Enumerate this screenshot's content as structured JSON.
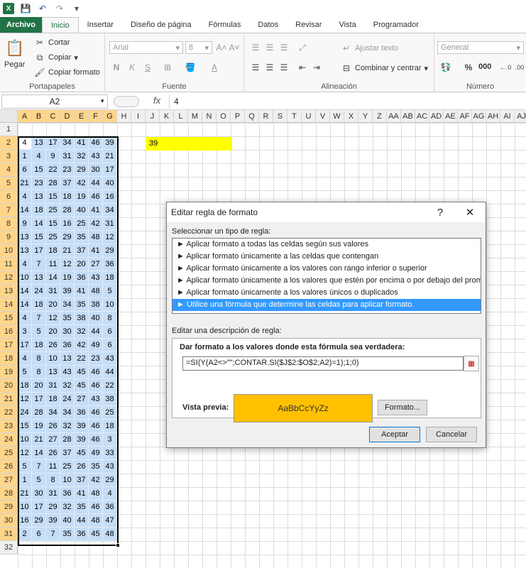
{
  "quick_access": {
    "save_icon": "save-icon",
    "undo_icon": "undo-icon",
    "redo_icon": "redo-icon"
  },
  "tabs": [
    "Archivo",
    "Inicio",
    "Insertar",
    "Diseño de página",
    "Fórmulas",
    "Datos",
    "Revisar",
    "Vista",
    "Programador"
  ],
  "active_tab": "Inicio",
  "ribbon": {
    "clipboard": {
      "paste": "Pegar",
      "cut": "Cortar",
      "copy": "Copiar",
      "format_painter": "Copiar formato",
      "label": "Portapapeles"
    },
    "font": {
      "name": "Arial",
      "size": "8",
      "bold": "N",
      "italic": "K",
      "underline": "S",
      "label": "Fuente"
    },
    "alignment": {
      "wrap": "Ajustar texto",
      "merge": "Combinar y centrar",
      "label": "Alineación"
    },
    "number": {
      "format": "General",
      "percent": "%",
      "thousands": "000",
      "label": "Número"
    }
  },
  "formula_bar": {
    "name_box": "A2",
    "fx": "fx",
    "value": "4"
  },
  "columns": [
    "A",
    "B",
    "C",
    "D",
    "E",
    "F",
    "G",
    "H",
    "I",
    "J",
    "K",
    "L",
    "M",
    "N",
    "O",
    "P",
    "Q",
    "R",
    "S",
    "T",
    "U",
    "V",
    "W",
    "X",
    "Y",
    "Z",
    "AA",
    "AB",
    "AC",
    "AD",
    "AE",
    "AF",
    "AG",
    "AH",
    "AI",
    "AJ"
  ],
  "rows": [
    "1",
    "2",
    "3",
    "4",
    "5",
    "6",
    "7",
    "8",
    "9",
    "10",
    "11",
    "12",
    "13",
    "14",
    "15",
    "16",
    "17",
    "18",
    "19",
    "20",
    "21",
    "22",
    "23",
    "24",
    "25",
    "26",
    "27",
    "28",
    "29",
    "30",
    "31",
    "32"
  ],
  "j2_value": "39",
  "data": [
    [
      "4",
      "13",
      "17",
      "34",
      "41",
      "46",
      "39"
    ],
    [
      "1",
      "4",
      "9",
      "31",
      "32",
      "43",
      "21"
    ],
    [
      "6",
      "15",
      "22",
      "23",
      "29",
      "30",
      "17"
    ],
    [
      "21",
      "23",
      "28",
      "37",
      "42",
      "44",
      "40"
    ],
    [
      "4",
      "13",
      "15",
      "18",
      "19",
      "46",
      "16"
    ],
    [
      "14",
      "18",
      "25",
      "28",
      "40",
      "41",
      "34"
    ],
    [
      "9",
      "14",
      "15",
      "16",
      "25",
      "42",
      "31"
    ],
    [
      "13",
      "15",
      "25",
      "29",
      "35",
      "48",
      "12"
    ],
    [
      "13",
      "17",
      "18",
      "21",
      "37",
      "41",
      "29"
    ],
    [
      "4",
      "7",
      "11",
      "12",
      "20",
      "27",
      "36"
    ],
    [
      "10",
      "13",
      "14",
      "19",
      "36",
      "43",
      "18"
    ],
    [
      "14",
      "24",
      "31",
      "39",
      "41",
      "48",
      "5"
    ],
    [
      "14",
      "18",
      "20",
      "34",
      "35",
      "38",
      "10"
    ],
    [
      "4",
      "7",
      "12",
      "35",
      "38",
      "40",
      "8"
    ],
    [
      "3",
      "5",
      "20",
      "30",
      "32",
      "44",
      "6"
    ],
    [
      "17",
      "18",
      "26",
      "36",
      "42",
      "49",
      "6"
    ],
    [
      "4",
      "8",
      "10",
      "13",
      "22",
      "23",
      "43"
    ],
    [
      "5",
      "8",
      "13",
      "43",
      "45",
      "46",
      "44"
    ],
    [
      "18",
      "20",
      "31",
      "32",
      "45",
      "46",
      "22"
    ],
    [
      "12",
      "17",
      "18",
      "24",
      "27",
      "43",
      "38"
    ],
    [
      "24",
      "28",
      "34",
      "34",
      "36",
      "46",
      "25"
    ],
    [
      "15",
      "19",
      "26",
      "32",
      "39",
      "46",
      "18"
    ],
    [
      "10",
      "21",
      "27",
      "28",
      "39",
      "46",
      "3"
    ],
    [
      "12",
      "14",
      "26",
      "37",
      "45",
      "49",
      "33"
    ],
    [
      "5",
      "7",
      "11",
      "25",
      "26",
      "35",
      "43"
    ],
    [
      "1",
      "5",
      "8",
      "10",
      "37",
      "42",
      "29"
    ],
    [
      "21",
      "30",
      "31",
      "36",
      "41",
      "48",
      "4"
    ],
    [
      "10",
      "17",
      "29",
      "32",
      "35",
      "46",
      "36"
    ],
    [
      "16",
      "29",
      "39",
      "40",
      "44",
      "48",
      "47"
    ],
    [
      "2",
      "6",
      "7",
      "35",
      "36",
      "45",
      "48"
    ]
  ],
  "dialog": {
    "title": "Editar regla de formato",
    "help": "?",
    "close": "✕",
    "select_label": "Seleccionar un tipo de regla:",
    "rules": [
      "► Aplicar formato a todas las celdas según sus valores",
      "► Aplicar formato únicamente a las celdas que contengan",
      "► Aplicar formato únicamente a los valores con rango inferior o superior",
      "► Aplicar formato únicamente a los valores que estén por encima o por debajo del promedio",
      "► Aplicar formato únicamente a los valores únicos o duplicados",
      "► Utilice una fórmula que determine las celdas para aplicar formato."
    ],
    "selected_rule": 5,
    "edit_label": "Editar una descripción de regla:",
    "formula_label": "Dar formato a los valores donde esta fórmula sea verdadera:",
    "formula": "=SI(Y(A2<>\"\";CONTAR.SI($J$2:$O$2;A2)=1);1;0)",
    "preview_label": "Vista previa:",
    "preview_text": "AaBbCcYyZz",
    "format_button": "Formato...",
    "ok": "Aceptar",
    "cancel": "Cancelar"
  },
  "colors": {
    "accent": "#217346",
    "selection_header": "#ffd58a",
    "data_fill": "#c5ddf6",
    "highlight": "#ffff00",
    "preview": "#ffc000",
    "selected_rule": "#3399ff"
  }
}
